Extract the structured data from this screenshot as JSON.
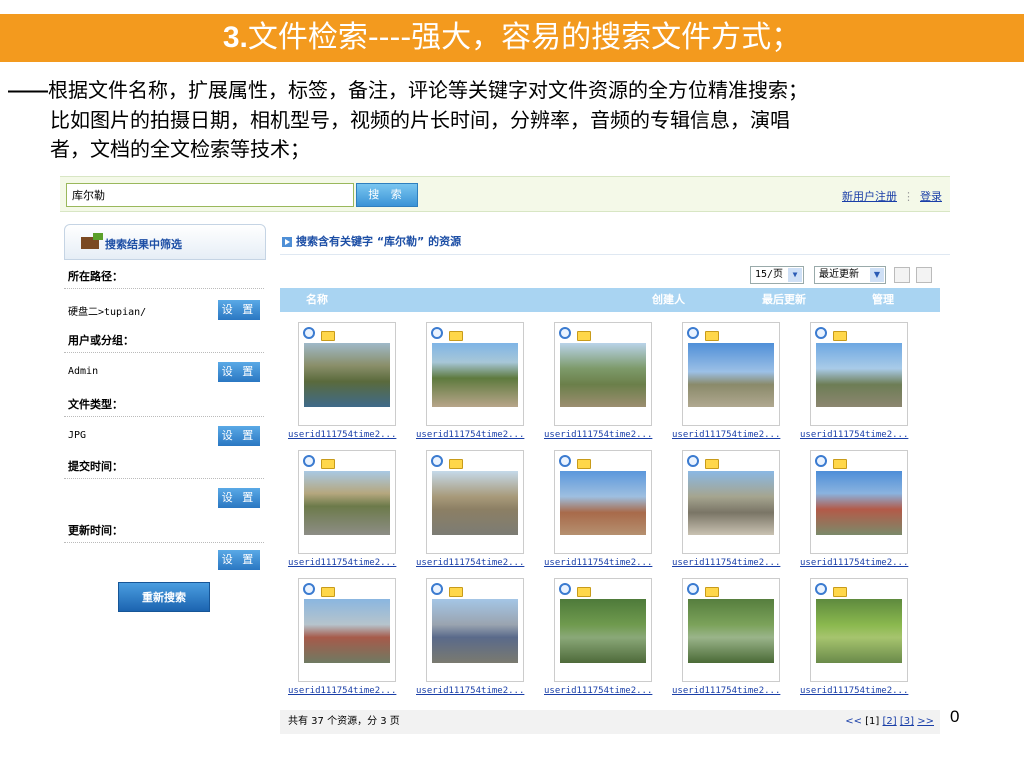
{
  "slide": {
    "title_num": "3.",
    "title_text": "文件检索----强大，容易的搜索文件方式；",
    "desc_dash": "——",
    "desc_line1": "根据文件名称，扩展属性，标签，备注，评论等关键字对文件资源的全方位精准搜索；",
    "desc_line2": "比如图片的拍摄日期，相机型号，视频的片长时间，分辨率，音频的专辑信息，演唱",
    "desc_line3": "者，文档的全文检索等技术；",
    "page_number": "0"
  },
  "topbar": {
    "search_value": "库尔勒",
    "search_button": "搜 索",
    "register_link": "新用户注册",
    "login_link": "登录"
  },
  "filters": {
    "header": "搜索结果中筛选",
    "path_label": "所在路径：",
    "path_value": "硬盘二>tupian/",
    "user_label": "用户或分组：",
    "user_value": "Admin",
    "type_label": "文件类型：",
    "type_value": "JPG",
    "submit_label": "提交时间：",
    "update_label": "更新时间：",
    "set_button": "设 置",
    "research_button": "重新搜索"
  },
  "results": {
    "heading": "搜索含有关键字 “库尔勒” 的资源",
    "per_page": "15/页",
    "sort": "最近更新",
    "columns": {
      "name": "名称",
      "creator": "创建人",
      "updated": "最后更新",
      "manage": "管理"
    },
    "caption": "userid111754time2...",
    "summary": "共有 37 个资源，分 3 页",
    "pager_prev": "<<",
    "pager_current": "[1]",
    "pager_2": "[2]",
    "pager_3": "[3]",
    "pager_next": ">>"
  },
  "colors": {
    "title_bg": "#f39a1e",
    "accent_blue": "#2a77c2",
    "link_blue": "#1a3fa8"
  }
}
